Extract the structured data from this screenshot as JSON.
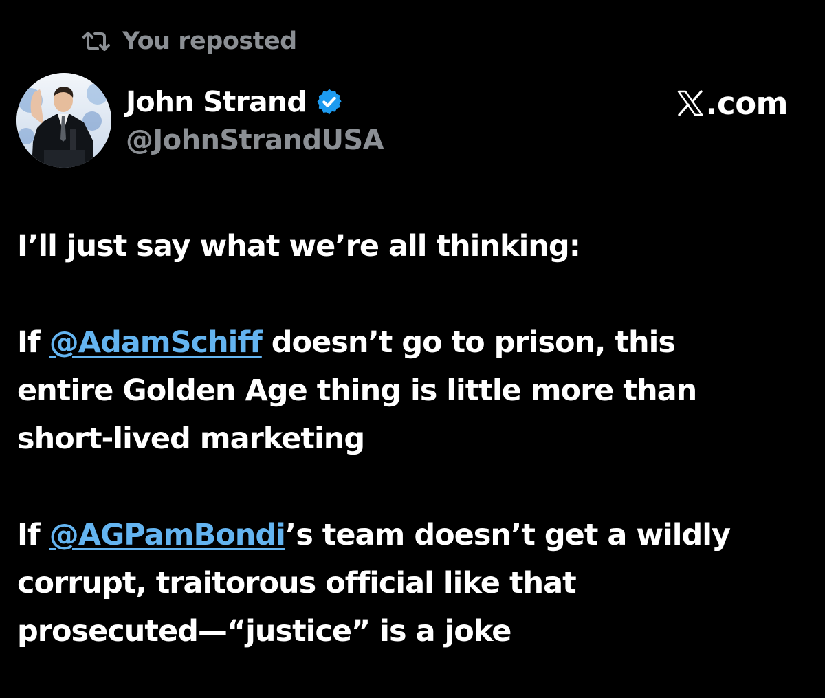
{
  "repost": {
    "icon": "repost-icon",
    "label": "You reposted"
  },
  "author": {
    "name": "John Strand",
    "handle": "@JohnStrandUSA",
    "verified": true,
    "verified_icon": "verified-badge-icon",
    "avatar": "avatar-photo"
  },
  "site": {
    "logo_icon": "x-logo-icon",
    "domain": ".com"
  },
  "post": {
    "line1": "I’ll just say what we’re all thinking:",
    "para2": {
      "lead": "If ",
      "mention": "@AdamSchiff",
      "rest1": " doesn’t go to prison, this",
      "line2": "entire Golden Age thing is little more than",
      "line3": "short-lived marketing"
    },
    "para3": {
      "lead": "If ",
      "mention": "@AGPamBondi",
      "rest1": "’s team doesn’t get a wildly",
      "line2": "corrupt, traitorous official like that",
      "line3": "prosecuted—“justice” is a joke"
    }
  },
  "colors": {
    "background": "#000000",
    "text": "#ffffff",
    "muted": "#8b8f94",
    "mention": "#64b4f0",
    "verified": "#1d9bf0"
  }
}
